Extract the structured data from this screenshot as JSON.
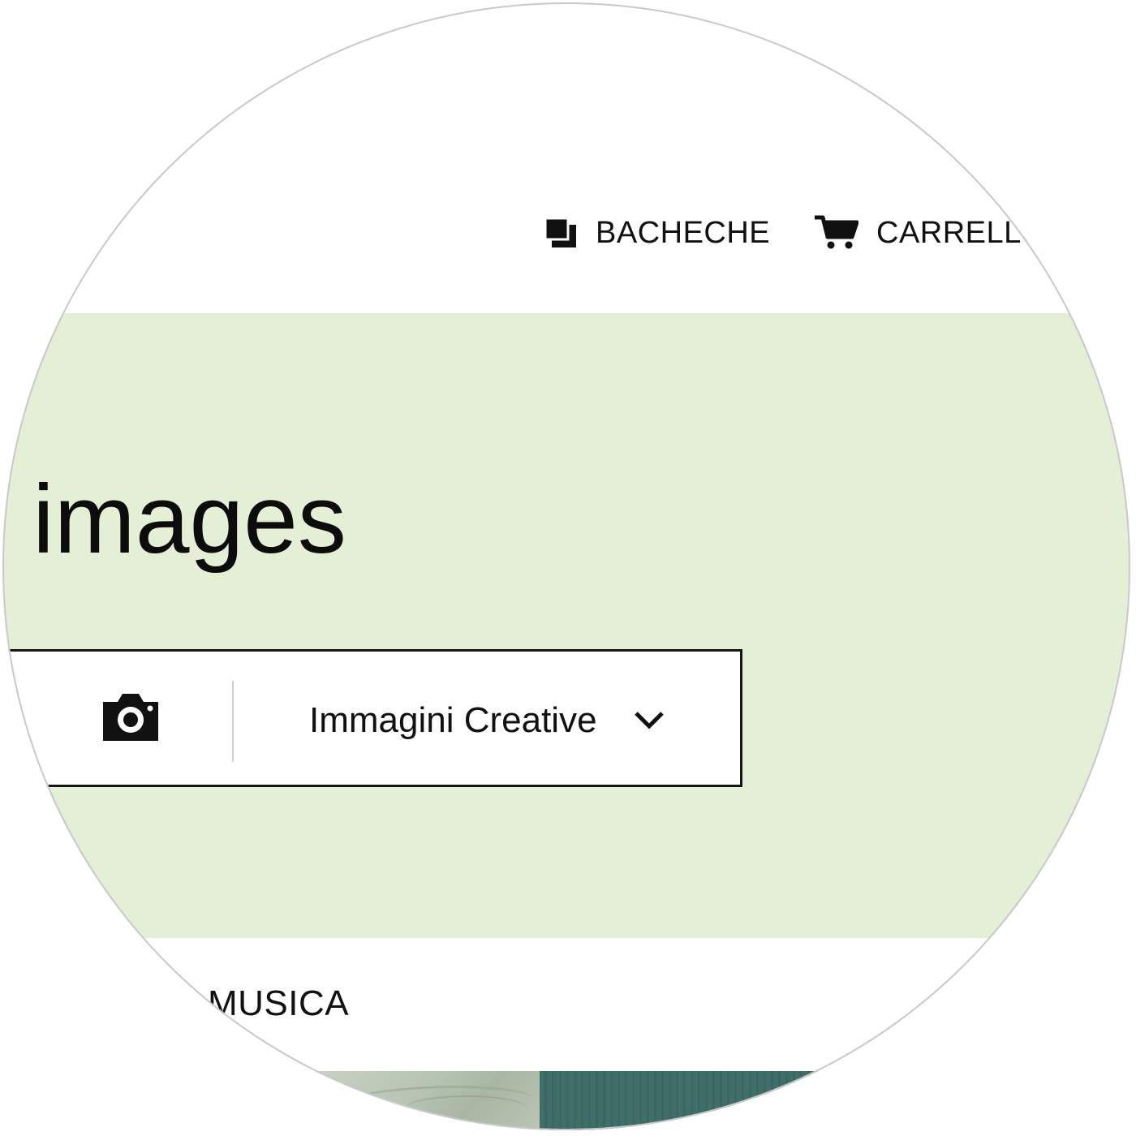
{
  "header": {
    "nav": [
      {
        "label": "BACHECHE",
        "icon": "boards-icon"
      },
      {
        "label": "CARRELLO",
        "icon": "cart-icon"
      }
    ]
  },
  "hero": {
    "title_fragment": "n images",
    "background_color": "#e4efd6"
  },
  "search": {
    "camera_icon": "camera-icon",
    "category_selected": "Immagini Creative",
    "dropdown_icon": "chevron-down-icon"
  },
  "categories": {
    "visible_tab": "MUSICA"
  }
}
